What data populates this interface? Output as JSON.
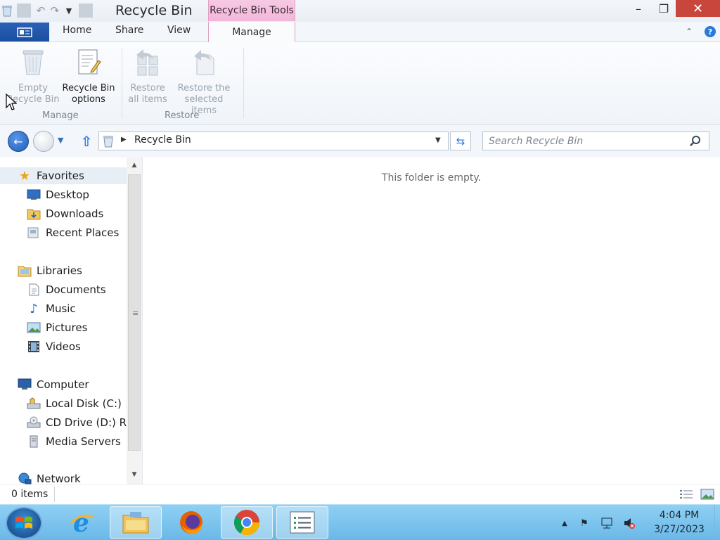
{
  "window": {
    "title": "Recycle Bin",
    "context_tab_header": "Recycle Bin Tools",
    "caption_min": "–",
    "caption_max": "❐",
    "caption_close": "✕"
  },
  "ribbon": {
    "tabs": {
      "home": "Home",
      "share": "Share",
      "view": "View",
      "manage": "Manage"
    },
    "buttons": {
      "empty_line1": "Empty",
      "empty_line2": "Recycle Bin",
      "options_line1": "Recycle Bin",
      "options_line2": "options",
      "restore_all_line1": "Restore",
      "restore_all_line2": "all items",
      "restore_sel_line1": "Restore the",
      "restore_sel_line2": "selected items"
    },
    "groups": {
      "manage": "Manage",
      "restore": "Restore"
    }
  },
  "address": {
    "location": "Recycle Bin",
    "search_placeholder": "Search Recycle Bin"
  },
  "nav": {
    "favorites": "Favorites",
    "desktop": "Desktop",
    "downloads": "Downloads",
    "recent_places": "Recent Places",
    "libraries": "Libraries",
    "documents": "Documents",
    "music": "Music",
    "pictures": "Pictures",
    "videos": "Videos",
    "computer": "Computer",
    "local_disk": "Local Disk (C:)",
    "cd_drive": "CD Drive (D:) RED",
    "media_servers": "Media Servers",
    "network": "Network"
  },
  "content": {
    "empty_message": "This folder is empty."
  },
  "status": {
    "item_count": "0 items"
  },
  "taskbar": {
    "time": "4:04 PM",
    "date": "3/27/2023"
  }
}
